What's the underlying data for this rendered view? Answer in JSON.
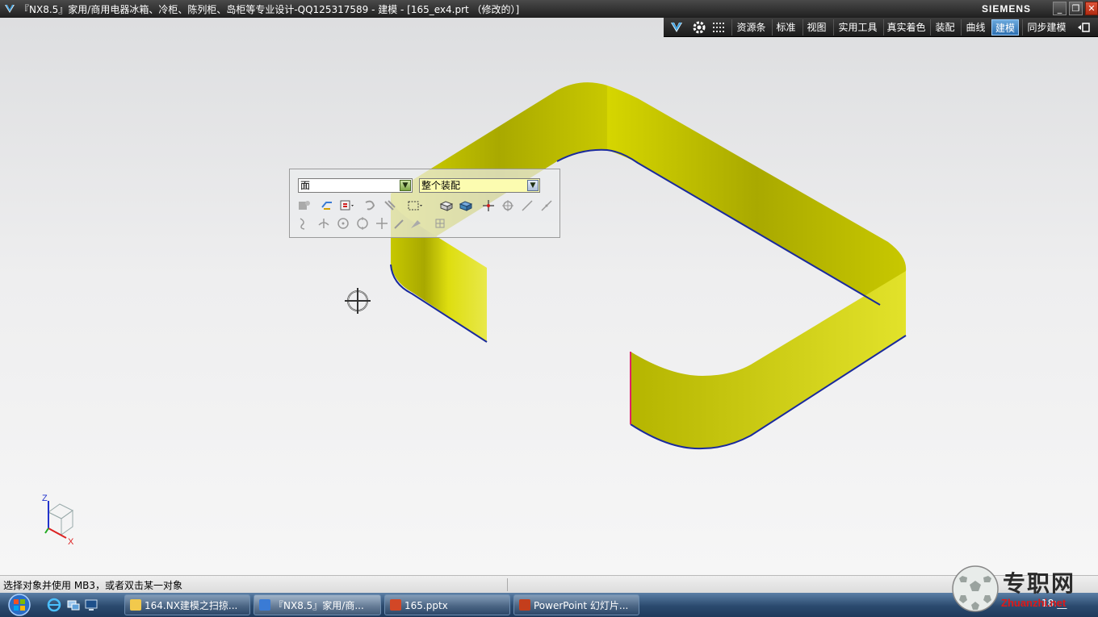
{
  "window": {
    "title": "『NX8.5』家用/商用电器冰箱、冷柜、陈列柜、岛柜等专业设计-QQ125317589 - 建模 - [165_ex4.prt （修改的）]",
    "brand": "SIEMENS",
    "buttons": [
      "_",
      "❐",
      "✕"
    ]
  },
  "ribbon": {
    "tabs": [
      "资源条",
      "标准",
      "视图",
      "实用工具",
      "真实着色",
      "装配",
      "曲线",
      "建模",
      "同步建模"
    ],
    "active_tab": "建模"
  },
  "selection_toolbar": {
    "type_filter": "面",
    "scope_filter": "整个装配",
    "row1_icons": [
      "snap-settings-icon",
      "select-all-icon",
      "filter-icon",
      "deselect-icon",
      "select-chain-icon",
      "rectangle-select-icon",
      "solid-body-icon",
      "shaded-body-icon",
      "move-icon",
      "rotate-icon",
      "line-icon",
      "line2-icon"
    ],
    "row2_icons": [
      "curve-icon",
      "point-icon",
      "center-icon",
      "circle-icon",
      "cross-icon",
      "pencil-icon",
      "paint-icon",
      "grid-icon"
    ]
  },
  "viewport": {
    "model_color": "#cfd000",
    "edge_color": "#1a2a9c",
    "triad_labels": {
      "z": "Z",
      "x": "X"
    }
  },
  "statusbar": {
    "message": "选择对象并使用 MB3，或者双击某一对象"
  },
  "taskbar": {
    "tasks": [
      {
        "label": "164.NX建模之扫掠...",
        "icon": "folder-icon",
        "active": false
      },
      {
        "label": "『NX8.5』家用/商...",
        "icon": "nx-app-icon",
        "active": true
      },
      {
        "label": "165.pptx",
        "icon": "pptx-icon",
        "active": false
      },
      {
        "label": "PowerPoint 幻灯片...",
        "icon": "powerpoint-icon",
        "active": false
      }
    ],
    "clock": "18:__"
  },
  "watermark": {
    "chinese": "专职网",
    "english": "Zhuanzhi.net"
  }
}
